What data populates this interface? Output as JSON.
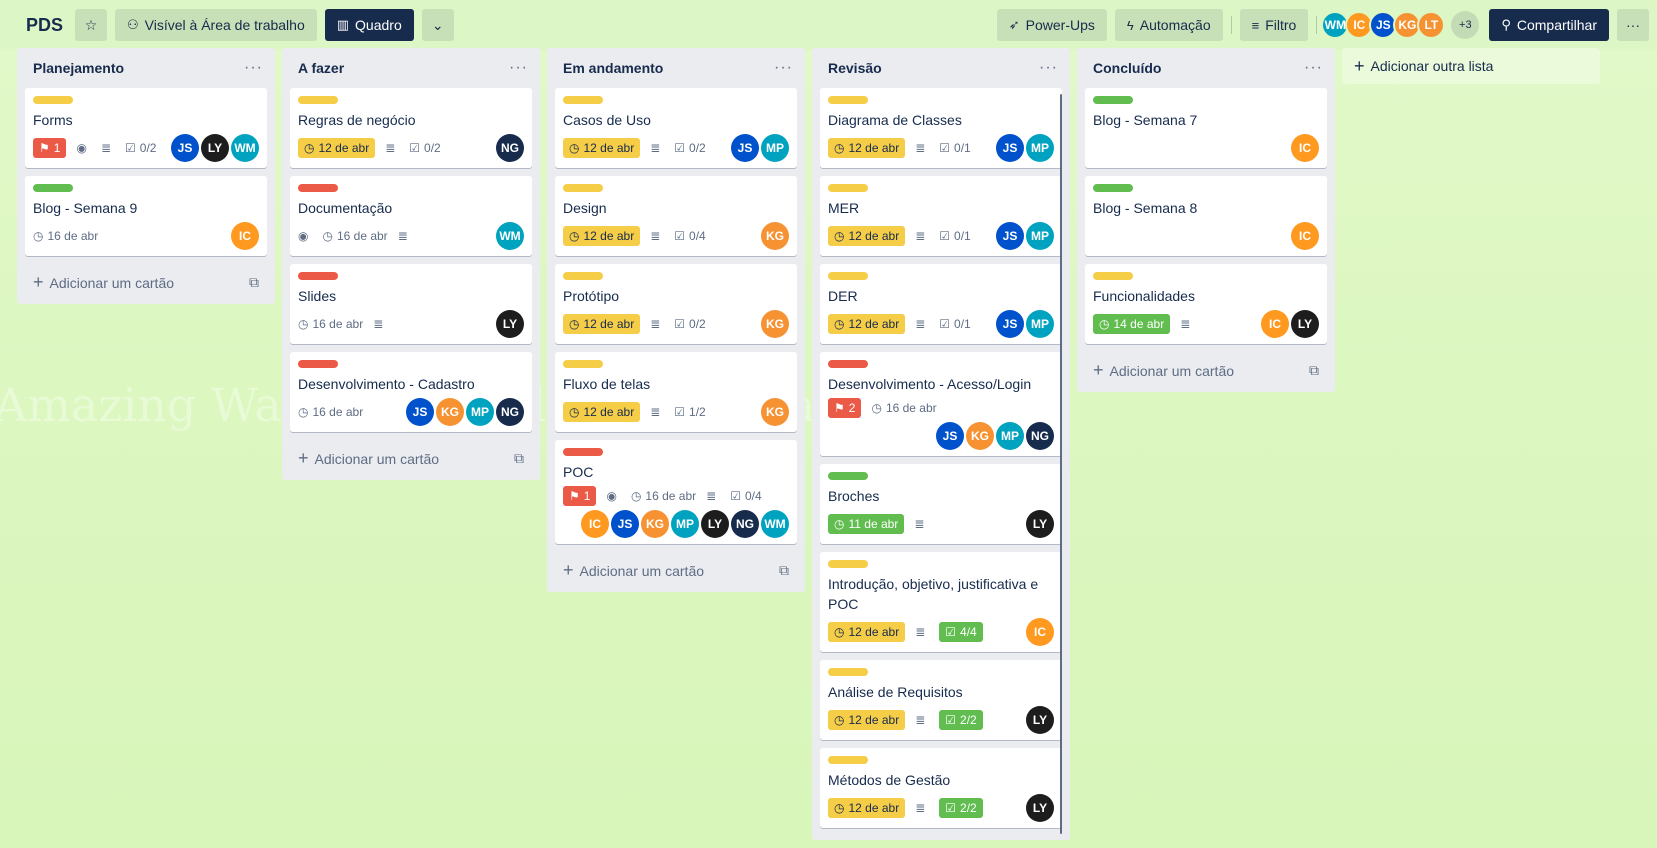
{
  "header": {
    "title": "PDS",
    "visibility": "Visível à Área de trabalho",
    "view": "Quadro",
    "powerups": "Power-Ups",
    "automation": "Automação",
    "filter": "Filtro",
    "more_members": "+3",
    "share": "Compartilhar",
    "members": [
      "WM",
      "IC",
      "JS",
      "KG",
      "LT"
    ]
  },
  "colors": {
    "WM": "#00a3bf",
    "IC": "#ff991f",
    "JS": "#0052cc",
    "KG": "#f79232",
    "LT": "#f79232",
    "LY": "#1d1d1d",
    "MP": "#00a3bf",
    "NG": "#172b4d",
    "yellow": "#f5cd47",
    "green": "#61bd4f",
    "red": "#eb5a46"
  },
  "watermark": "Amazing Walls.com Walls.com Amazing W",
  "add_card_label": "Adicionar um cartão",
  "add_list_label": "Adicionar outra lista",
  "lists": [
    {
      "title": "Planejamento",
      "cards": [
        {
          "label": "yellow",
          "title": "Forms",
          "badges": [
            {
              "type": "red",
              "icon": "flag",
              "text": "1"
            },
            {
              "icon": "eye",
              "text": ""
            },
            {
              "icon": "desc",
              "text": ""
            },
            {
              "icon": "check",
              "text": "0/2"
            }
          ],
          "members": [
            "JS",
            "LY",
            "WM"
          ]
        },
        {
          "label": "green",
          "title": "Blog - Semana 9",
          "badges": [
            {
              "icon": "clock",
              "text": "16 de abr"
            }
          ],
          "members": [
            "IC"
          ]
        }
      ]
    },
    {
      "title": "A fazer",
      "cards": [
        {
          "label": "yellow",
          "title": "Regras de negócio",
          "badges": [
            {
              "type": "yellow",
              "icon": "clock",
              "text": "12 de abr"
            },
            {
              "icon": "desc",
              "text": ""
            },
            {
              "icon": "check",
              "text": "0/2"
            }
          ],
          "members": [
            "NG"
          ]
        },
        {
          "label": "red",
          "title": "Documentação",
          "badges": [
            {
              "icon": "eye",
              "text": ""
            },
            {
              "icon": "clock",
              "text": "16 de abr"
            },
            {
              "icon": "desc",
              "text": ""
            }
          ],
          "members": [
            "WM"
          ]
        },
        {
          "label": "red",
          "title": "Slides",
          "badges": [
            {
              "icon": "clock",
              "text": "16 de abr"
            },
            {
              "icon": "desc",
              "text": ""
            }
          ],
          "members": [
            "LY"
          ]
        },
        {
          "label": "red",
          "title": "Desenvolvimento - Cadastro",
          "badges": [
            {
              "icon": "clock",
              "text": "16 de abr"
            }
          ],
          "members": [
            "JS",
            "KG",
            "MP",
            "NG"
          ]
        }
      ]
    },
    {
      "title": "Em andamento",
      "cards": [
        {
          "label": "yellow",
          "title": "Casos de Uso",
          "badges": [
            {
              "type": "yellow",
              "icon": "clock",
              "text": "12 de abr"
            },
            {
              "icon": "desc",
              "text": ""
            },
            {
              "icon": "check",
              "text": "0/2"
            }
          ],
          "members": [
            "JS",
            "MP"
          ]
        },
        {
          "label": "yellow",
          "title": "Design",
          "badges": [
            {
              "type": "yellow",
              "icon": "clock",
              "text": "12 de abr"
            },
            {
              "icon": "desc",
              "text": ""
            },
            {
              "icon": "check",
              "text": "0/4"
            }
          ],
          "members": [
            "KG"
          ]
        },
        {
          "label": "yellow",
          "title": "Protótipo",
          "badges": [
            {
              "type": "yellow",
              "icon": "clock",
              "text": "12 de abr"
            },
            {
              "icon": "desc",
              "text": ""
            },
            {
              "icon": "check",
              "text": "0/2"
            }
          ],
          "members": [
            "KG"
          ]
        },
        {
          "label": "yellow",
          "title": "Fluxo de telas",
          "badges": [
            {
              "type": "yellow",
              "icon": "clock",
              "text": "12 de abr"
            },
            {
              "icon": "desc",
              "text": ""
            },
            {
              "icon": "check",
              "text": "1/2"
            }
          ],
          "members": [
            "KG"
          ]
        },
        {
          "label": "red",
          "title": "POC",
          "badges": [
            {
              "type": "red",
              "icon": "flag",
              "text": "1"
            },
            {
              "icon": "eye",
              "text": ""
            },
            {
              "icon": "clock",
              "text": "16 de abr"
            },
            {
              "icon": "desc",
              "text": ""
            },
            {
              "icon": "check",
              "text": "0/4"
            }
          ],
          "members": [
            "IC",
            "JS",
            "KG",
            "MP",
            "LY",
            "NG",
            "WM"
          ],
          "members_wrap": true
        }
      ]
    },
    {
      "title": "Revisão",
      "cards": [
        {
          "label": "yellow",
          "title": "Diagrama de Classes",
          "badges": [
            {
              "type": "yellow",
              "icon": "clock",
              "text": "12 de abr"
            },
            {
              "icon": "desc",
              "text": ""
            },
            {
              "icon": "check",
              "text": "0/1"
            }
          ],
          "members": [
            "JS",
            "MP"
          ]
        },
        {
          "label": "yellow",
          "title": "MER",
          "badges": [
            {
              "type": "yellow",
              "icon": "clock",
              "text": "12 de abr"
            },
            {
              "icon": "desc",
              "text": ""
            },
            {
              "icon": "check",
              "text": "0/1"
            }
          ],
          "members": [
            "JS",
            "MP"
          ]
        },
        {
          "label": "yellow",
          "title": "DER",
          "badges": [
            {
              "type": "yellow",
              "icon": "clock",
              "text": "12 de abr"
            },
            {
              "icon": "desc",
              "text": ""
            },
            {
              "icon": "check",
              "text": "0/1"
            }
          ],
          "members": [
            "JS",
            "MP"
          ]
        },
        {
          "label": "red",
          "title": "Desenvolvimento - Acesso/Login",
          "badges": [
            {
              "type": "red",
              "icon": "flag",
              "text": "2"
            },
            {
              "icon": "clock",
              "text": "16 de abr"
            }
          ],
          "members": [
            "JS",
            "KG",
            "MP",
            "NG"
          ],
          "members_wrap": true
        },
        {
          "label": "green",
          "title": "Broches",
          "badges": [
            {
              "type": "green",
              "icon": "clock",
              "text": "11 de abr"
            },
            {
              "icon": "desc",
              "text": ""
            }
          ],
          "members": [
            "LY"
          ]
        },
        {
          "label": "yellow",
          "title": "Introdução, objetivo, justificativa e POC",
          "badges": [
            {
              "type": "yellow",
              "icon": "clock",
              "text": "12 de abr"
            },
            {
              "icon": "desc",
              "text": ""
            },
            {
              "type": "green",
              "icon": "check",
              "text": "4/4"
            }
          ],
          "members": [
            "IC"
          ]
        },
        {
          "label": "yellow",
          "title": "Análise de Requisitos",
          "badges": [
            {
              "type": "yellow",
              "icon": "clock",
              "text": "12 de abr"
            },
            {
              "icon": "desc",
              "text": ""
            },
            {
              "type": "green",
              "icon": "check",
              "text": "2/2"
            }
          ],
          "members": [
            "LY"
          ]
        },
        {
          "label": "yellow",
          "title": "Métodos de Gestão",
          "badges": [
            {
              "type": "yellow",
              "icon": "clock",
              "text": "12 de abr"
            },
            {
              "icon": "desc",
              "text": ""
            },
            {
              "type": "green",
              "icon": "check",
              "text": "2/2"
            }
          ],
          "members": [
            "LY"
          ]
        }
      ]
    },
    {
      "title": "Concluído",
      "cards": [
        {
          "label": "green",
          "title": "Blog - Semana 7",
          "badges": [],
          "members": [
            "IC"
          ]
        },
        {
          "label": "green",
          "title": "Blog - Semana 8",
          "badges": [],
          "members": [
            "IC"
          ]
        },
        {
          "label": "yellow",
          "title": "Funcionalidades",
          "badges": [
            {
              "type": "green",
              "icon": "clock",
              "text": "14 de abr"
            },
            {
              "icon": "desc",
              "text": ""
            }
          ],
          "members": [
            "IC",
            "LY"
          ]
        }
      ]
    }
  ]
}
